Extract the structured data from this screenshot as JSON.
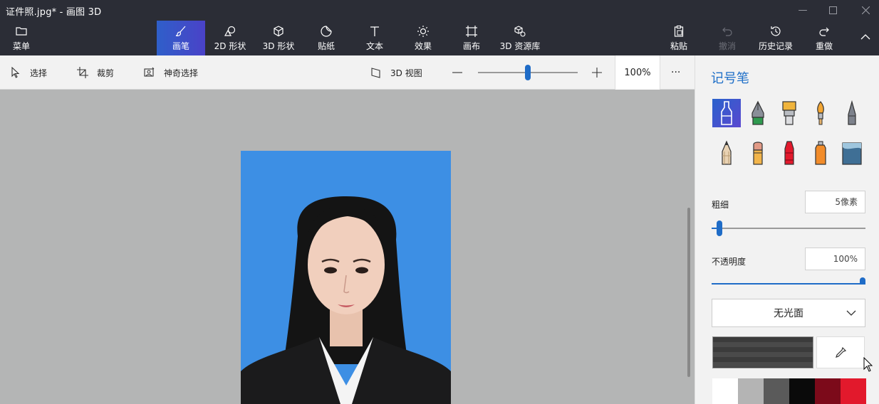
{
  "window": {
    "title": "证件照.jpg* - 画图 3D",
    "minimize_icon": "minimize-icon",
    "maximize_icon": "maximize-icon",
    "close_icon": "close-icon"
  },
  "ribbon": {
    "menu": "菜单",
    "tools": [
      {
        "id": "brush",
        "label": "画笔",
        "icon": "brush-icon",
        "active": true
      },
      {
        "id": "shapes2d",
        "label": "2D 形状",
        "icon": "shapes-2d-icon"
      },
      {
        "id": "shapes3d",
        "label": "3D 形状",
        "icon": "cube-icon"
      },
      {
        "id": "stickers",
        "label": "贴纸",
        "icon": "sticker-icon"
      },
      {
        "id": "text",
        "label": "文本",
        "icon": "text-icon"
      },
      {
        "id": "effects",
        "label": "效果",
        "icon": "sun-icon"
      },
      {
        "id": "canvas",
        "label": "画布",
        "icon": "canvas-icon"
      },
      {
        "id": "library3d",
        "label": "3D 资源库",
        "icon": "library-icon"
      }
    ],
    "paste": "粘贴",
    "undo": "撤消",
    "history": "历史记录",
    "redo": "重做"
  },
  "toolbar": {
    "select": "选择",
    "crop": "裁剪",
    "magic_select": "神奇选择",
    "view3d": "3D 视图",
    "zoom_value": "100%",
    "zoom_fraction": 0.5,
    "more": "···"
  },
  "panel": {
    "title": "记号笔",
    "brushes": [
      {
        "name": "marker",
        "selected": true
      },
      {
        "name": "calligraphy-pen"
      },
      {
        "name": "oil-brush"
      },
      {
        "name": "watercolor"
      },
      {
        "name": "pixel-pen"
      },
      {
        "name": "pencil"
      },
      {
        "name": "eraser"
      },
      {
        "name": "crayon"
      },
      {
        "name": "spray-can"
      },
      {
        "name": "fill-bucket"
      }
    ],
    "thickness_label": "粗细",
    "thickness_value": "5像素",
    "thickness_fraction": 0.05,
    "opacity_label": "不透明度",
    "opacity_value": "100%",
    "opacity_fraction": 1.0,
    "finish": "无光面",
    "current_color": "#3b3b3b",
    "palette": [
      "#ffffff",
      "#b4b4b4",
      "#5a5a5a",
      "#0a0a0a",
      "#7c0a1a",
      "#e2192c"
    ]
  },
  "colors": {
    "accent": "#1f6cc7",
    "photo_background": "#3d8fe4"
  }
}
